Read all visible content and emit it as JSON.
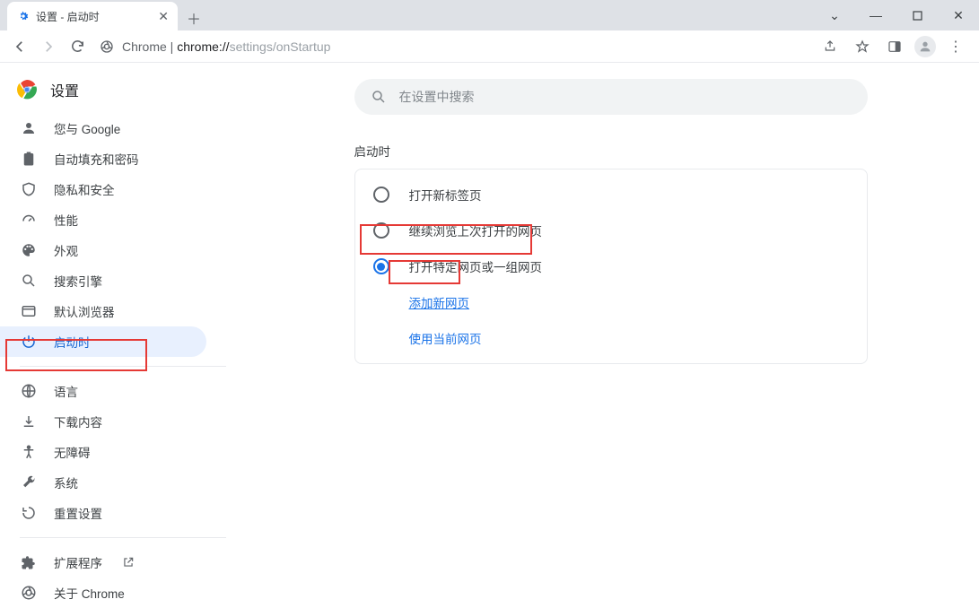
{
  "window": {
    "tab_title": "设置 - 启动时",
    "controls": {
      "min": "—",
      "max": "▢",
      "close": "✕",
      "down": "⌄"
    }
  },
  "toolbar": {
    "url_prefix": "Chrome",
    "url_sep": " | ",
    "url_scheme": "chrome://",
    "url_path": "settings/onStartup"
  },
  "sidebar": {
    "title": "设置",
    "items": [
      {
        "icon": "person",
        "label": "您与 Google"
      },
      {
        "icon": "autofill",
        "label": "自动填充和密码"
      },
      {
        "icon": "shield",
        "label": "隐私和安全"
      },
      {
        "icon": "speed",
        "label": "性能"
      },
      {
        "icon": "palette",
        "label": "外观"
      },
      {
        "icon": "search",
        "label": "搜索引擎"
      },
      {
        "icon": "browser",
        "label": "默认浏览器"
      },
      {
        "icon": "power",
        "label": "启动时",
        "active": true
      }
    ],
    "items2": [
      {
        "icon": "globe",
        "label": "语言"
      },
      {
        "icon": "download",
        "label": "下载内容"
      },
      {
        "icon": "a11y",
        "label": "无障碍"
      },
      {
        "icon": "wrench",
        "label": "系统"
      },
      {
        "icon": "reset",
        "label": "重置设置"
      }
    ],
    "items3": [
      {
        "icon": "ext",
        "label": "扩展程序",
        "external": true
      },
      {
        "icon": "chrome",
        "label": "关于 Chrome"
      }
    ]
  },
  "search": {
    "placeholder": "在设置中搜索"
  },
  "main": {
    "section_title": "启动时",
    "options": [
      {
        "label": "打开新标签页"
      },
      {
        "label": "继续浏览上次打开的网页"
      },
      {
        "label": "打开特定网页或一组网页",
        "selected": true
      }
    ],
    "links": {
      "add": "添加新网页",
      "use_current": "使用当前网页"
    }
  }
}
